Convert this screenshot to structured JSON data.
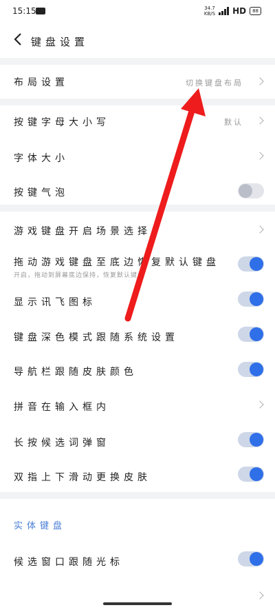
{
  "status": {
    "time": "15:15",
    "speed_value": "34.7",
    "speed_unit": "KB/S",
    "network": "HD",
    "battery": "88"
  },
  "header": {
    "title": "键盘设置"
  },
  "rows": {
    "layout": {
      "label": "布局设置",
      "value": "切换键盘布局"
    },
    "case": {
      "label": "按键字母大小写",
      "value": "默认"
    },
    "font": {
      "label": "字体大小"
    },
    "bubble": {
      "label": "按键气泡"
    },
    "game_scene": {
      "label": "游戏键盘开启场景选择"
    },
    "drag_restore": {
      "label": "拖动游戏键盘至底边恢复默认键盘",
      "sub": "开启，拖动到屏幕底边保持，恢复默认键盘"
    },
    "xunfei_icon": {
      "label": "显示讯飞图标"
    },
    "dark_follow": {
      "label": "键盘深色模式跟随系统设置"
    },
    "nav_color": {
      "label": "导航栏跟随皮肤颜色"
    },
    "pinyin_in_box": {
      "label": "拼音在输入框内"
    },
    "long_press_popup": {
      "label": "长按候选词弹窗"
    },
    "two_finger_skin": {
      "label": "双指上下滑动更换皮肤"
    },
    "candidate_cursor": {
      "label": "候选窗口跟随光标"
    }
  },
  "section": {
    "physical_keyboard": "实体键盘"
  },
  "toggles": {
    "bubble": false,
    "drag_restore": true,
    "xunfei_icon": true,
    "dark_follow": true,
    "nav_color": true,
    "long_press_popup": true,
    "two_finger_skin": true,
    "candidate_cursor": true
  },
  "colors": {
    "accent": "#2f6fe8",
    "section_title": "#4a7fd6",
    "annotation_arrow": "#ee1c1c"
  }
}
